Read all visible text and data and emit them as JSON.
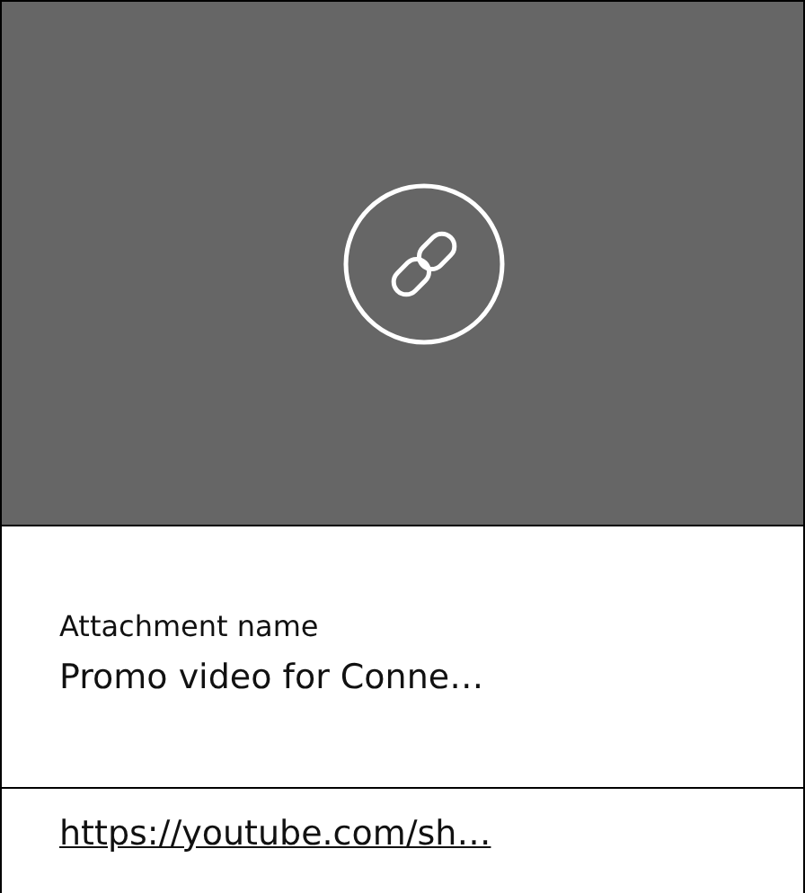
{
  "attachment": {
    "label": "Attachment name",
    "name": "Promo video for Conne…",
    "url": "https://youtube.com/sh…"
  }
}
